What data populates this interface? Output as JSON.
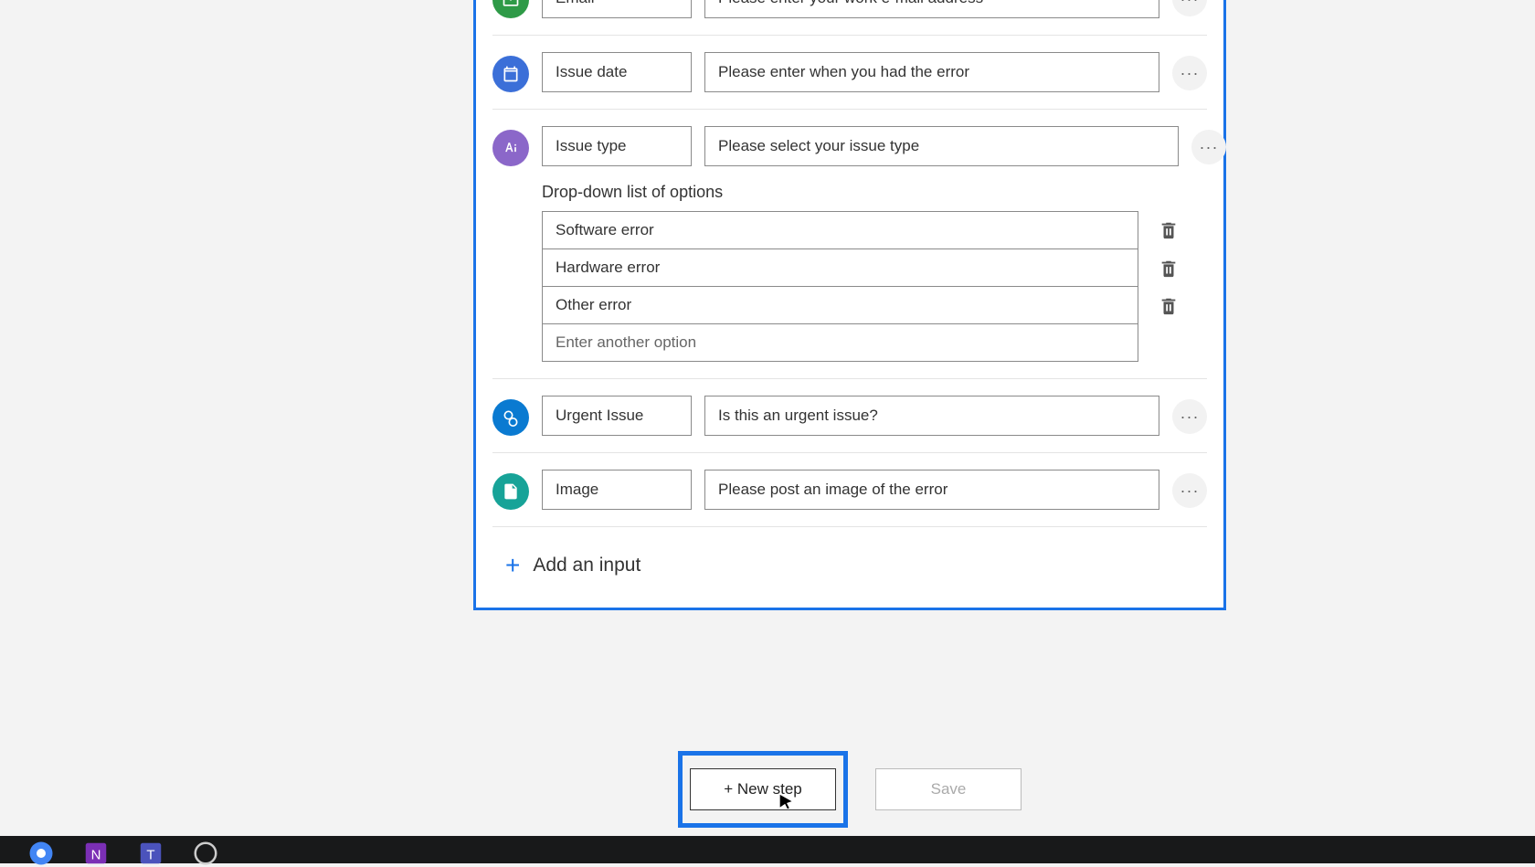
{
  "inputs": {
    "email": {
      "label": "Email",
      "desc": "Please enter your work e-mail address",
      "color": "#2e9a47"
    },
    "date": {
      "label": "Issue date",
      "desc": "Please enter when you had the error",
      "color": "#3b6fd8"
    },
    "type": {
      "label": "Issue type",
      "desc": "Please select your issue type",
      "color": "#8b67c9"
    },
    "urgent": {
      "label": "Urgent Issue",
      "desc": "Is this an urgent issue?",
      "color": "#0a7ad1"
    },
    "image": {
      "label": "Image",
      "desc": "Please post an image of the error",
      "color": "#17a398"
    }
  },
  "dropdown": {
    "title": "Drop-down list of options",
    "options": [
      "Software error",
      "Hardware error",
      "Other error"
    ],
    "placeholder": "Enter another option"
  },
  "add_input": "Add an input",
  "buttons": {
    "new_step": "+ New step",
    "save": "Save"
  },
  "more": "···"
}
